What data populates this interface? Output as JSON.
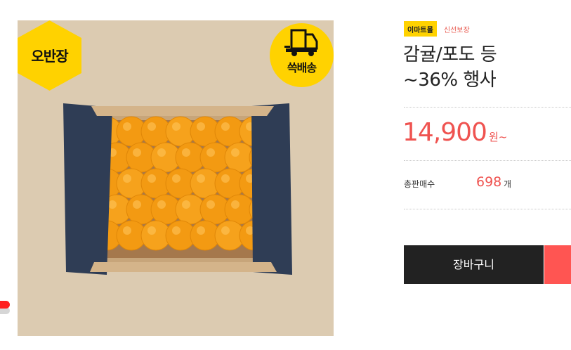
{
  "badges": {
    "left": "오반장",
    "right": "쓱배송"
  },
  "brand": {
    "store": "이마트몰",
    "tag": "신선보장"
  },
  "product": {
    "title_line1": "감귤/포도 등",
    "title_line2": "~36% 행사",
    "price": "14,900",
    "price_unit": "원~"
  },
  "sales": {
    "label": "총판매수",
    "count": "698",
    "unit": "개"
  },
  "cart": {
    "label": "장바구니"
  },
  "colors": {
    "accent": "#ef5350",
    "badge_yellow": "#ffd200",
    "cart_dark": "#222222",
    "cart_accent": "#ff5552"
  },
  "icons": {
    "delivery": "delivery-truck-icon"
  }
}
